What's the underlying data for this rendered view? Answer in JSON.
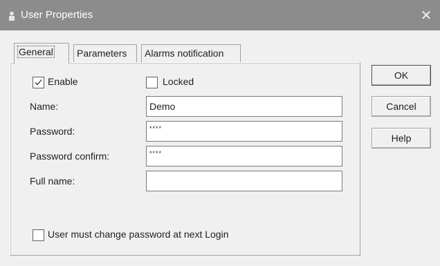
{
  "window": {
    "title": "User Properties",
    "close_glyph": "✕"
  },
  "tabs": [
    {
      "label": "General"
    },
    {
      "label": "Parameters"
    },
    {
      "label": "Alarms notification"
    }
  ],
  "general": {
    "enable_label": "Enable",
    "enable_checked": true,
    "locked_label": "Locked",
    "locked_checked": false,
    "name_label": "Name:",
    "name_value": "Demo",
    "password_label": "Password:",
    "password_value": "****",
    "password_confirm_label": "Password confirm:",
    "password_confirm_value": "****",
    "full_name_label": "Full name:",
    "full_name_value": "",
    "must_change_label": "User must change password at next Login",
    "must_change_checked": false
  },
  "buttons": {
    "ok": "OK",
    "cancel": "Cancel",
    "help": "Help"
  }
}
